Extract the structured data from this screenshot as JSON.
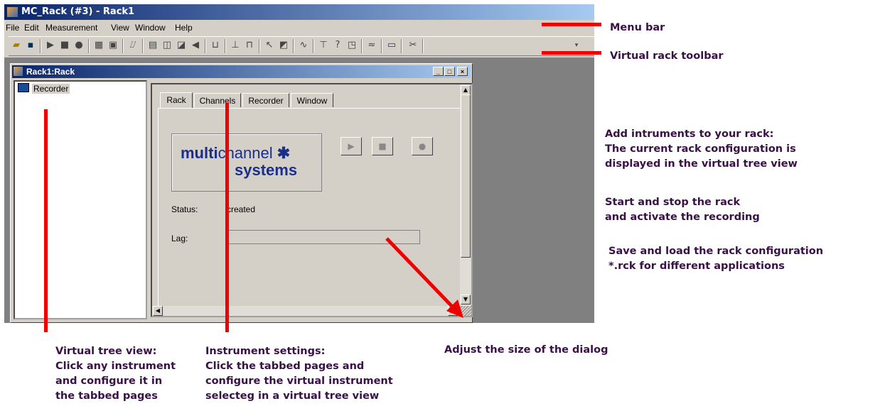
{
  "window": {
    "title": "MC_Rack (#3) - Rack1"
  },
  "menu": [
    "File",
    "Edit",
    "Measurement",
    "View",
    "Window",
    "Help"
  ],
  "toolbar_icons": [
    "open-folder-icon",
    "save-icon",
    "play-icon",
    "stop-icon",
    "record-icon",
    "grid-icon",
    "display-icon",
    "chart-icon",
    "table-icon",
    "spike-icon",
    "sound-icon",
    "filter-icon",
    "trigger-icon",
    "analyzer-icon",
    "burst-icon",
    "cursor-icon",
    "help-icon",
    "expand-icon",
    "waveform-icon",
    "panel-icon",
    "cut-icon"
  ],
  "rack_window": {
    "title": "Rack1:Rack",
    "controls": {
      "minimize": "_",
      "restore": "□",
      "close": "×"
    }
  },
  "tree": {
    "items": [
      {
        "label": "Recorder"
      }
    ]
  },
  "tabs": [
    "Rack",
    "Channels",
    "Recorder",
    "Window"
  ],
  "logo": {
    "line1_bold": "multi",
    "line1_thin": "channel",
    "star": "✱",
    "line2": "systems"
  },
  "controls": {
    "play": "▶",
    "stop": "■",
    "record": "●"
  },
  "status": {
    "label": "Status:",
    "value": "created"
  },
  "lag": {
    "label": "Lag:",
    "value": ""
  },
  "annotations": {
    "menu_bar": "Menu bar",
    "toolbar": "Virtual rack toolbar",
    "add_instruments": [
      "Add intruments to your rack:",
      "The current rack configuration is",
      "displayed in the virtual tree view"
    ],
    "start_stop": [
      "Start and stop the rack",
      "and activate the recording"
    ],
    "save_load": [
      "Save and load the rack configuration",
      "*.rck for different applications"
    ],
    "tree_view": [
      "Virtual tree view:",
      "Click any instrument",
      "and configure it in",
      "the tabbed pages"
    ],
    "instrument_settings": [
      "Instrument settings:",
      "Click the tabbed pages and",
      "configure the virtual instrument",
      "selecteg in a virtual tree view"
    ],
    "adjust_size": "Adjust the size of the dialog"
  },
  "colors": {
    "annotation": "#3a1048",
    "arrow": "#ee0000",
    "titlebar": "#0a246a",
    "logo": "#1a2f8c"
  }
}
